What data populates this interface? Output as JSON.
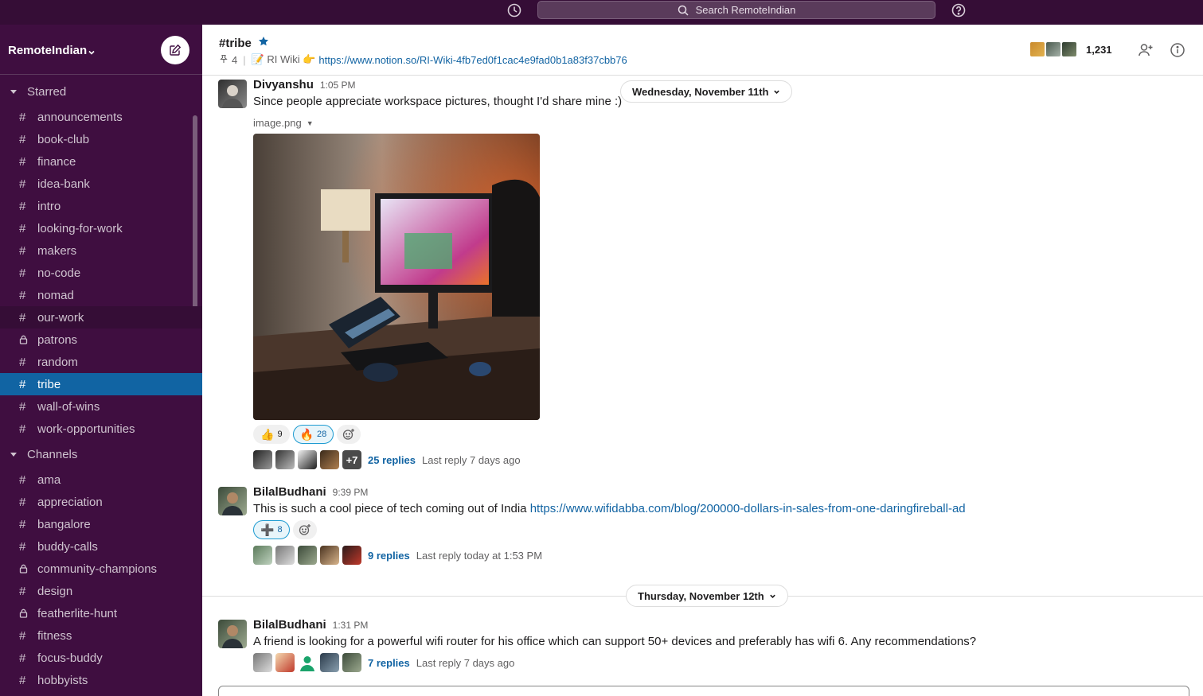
{
  "topbar": {
    "search_placeholder": "Search RemoteIndian",
    "history_icon": "clock-icon",
    "help_icon": "help-icon"
  },
  "sidebar": {
    "workspace": "RemoteIndian",
    "sections": {
      "starred": "Starred",
      "channels": "Channels"
    },
    "starred_items": [
      {
        "label": "announcements",
        "type": "public"
      },
      {
        "label": "book-club",
        "type": "public"
      },
      {
        "label": "finance",
        "type": "public"
      },
      {
        "label": "idea-bank",
        "type": "public"
      },
      {
        "label": "intro",
        "type": "public"
      },
      {
        "label": "looking-for-work",
        "type": "public"
      },
      {
        "label": "makers",
        "type": "public"
      },
      {
        "label": "no-code",
        "type": "public"
      },
      {
        "label": "nomad",
        "type": "public"
      },
      {
        "label": "our-work",
        "type": "public"
      },
      {
        "label": "patrons",
        "type": "private"
      },
      {
        "label": "random",
        "type": "public"
      },
      {
        "label": "tribe",
        "type": "public",
        "active": true
      },
      {
        "label": "wall-of-wins",
        "type": "public"
      },
      {
        "label": "work-opportunities",
        "type": "public"
      }
    ],
    "channel_items": [
      {
        "label": "ama",
        "type": "public"
      },
      {
        "label": "appreciation",
        "type": "public"
      },
      {
        "label": "bangalore",
        "type": "public"
      },
      {
        "label": "buddy-calls",
        "type": "public"
      },
      {
        "label": "community-champions",
        "type": "private"
      },
      {
        "label": "design",
        "type": "public"
      },
      {
        "label": "featherlite-hunt",
        "type": "private"
      },
      {
        "label": "fitness",
        "type": "public"
      },
      {
        "label": "focus-buddy",
        "type": "public"
      },
      {
        "label": "hobbyists",
        "type": "public"
      }
    ]
  },
  "channel": {
    "name": "#tribe",
    "pinned_count": "4",
    "bookmark_label": "📝 RI Wiki 👉",
    "bookmark_url": "https://www.notion.so/RI-Wiki-4fb7ed0f1cac4e9fad0b1a83f37cbb76",
    "member_count": "1,231"
  },
  "messages": [
    {
      "author": "Divyanshu",
      "time": "1:05 PM",
      "text": "Since people appreciate workspace pictures, thought I'd share mine :)",
      "file_name": "image.png",
      "reactions": [
        {
          "emoji": "👍",
          "count": "9"
        },
        {
          "emoji": "🔥",
          "count": "28",
          "mine": true
        }
      ],
      "thread_more": "+7",
      "replies": "25 replies",
      "last_reply": "Last reply 7 days ago"
    },
    {
      "author": "BilalBudhani",
      "time": "9:39 PM",
      "text": "This is such a cool piece of tech coming out of India ",
      "link": "https://www.wifidabba.com/blog/200000-dollars-in-sales-from-one-daringfireball-ad",
      "reactions": [
        {
          "emoji": "➕",
          "count": "8",
          "mine": true
        }
      ],
      "replies": "9 replies",
      "last_reply": "Last reply today at 1:53 PM"
    },
    {
      "author": "BilalBudhani",
      "time": "1:31 PM",
      "text": "A friend is looking for a powerful wifi router for his office which can support 50+ devices and preferably has wifi 6. Any recommendations?",
      "replies": "7 replies",
      "last_reply": "Last reply 7 days ago"
    }
  ],
  "dates": {
    "first": "Wednesday, November 11th",
    "second": "Thursday, November 12th"
  }
}
